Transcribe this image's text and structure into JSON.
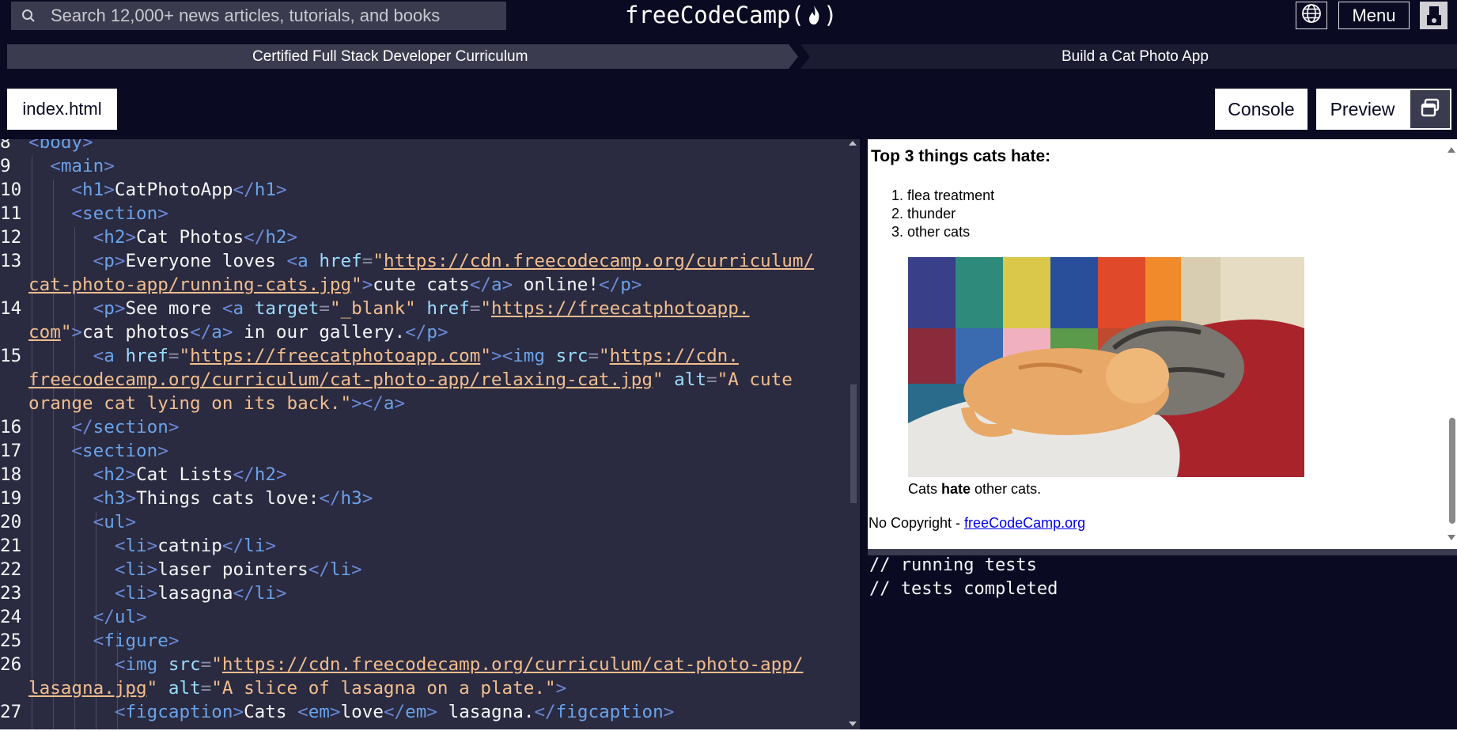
{
  "topnav": {
    "search_placeholder": "Search 12,000+ news articles, tutorials, and books",
    "logo_text": "freeCodeCamp",
    "logo_open": "(",
    "logo_close": ")",
    "menu_label": "Menu"
  },
  "breadcrumb": {
    "items": [
      "Certified Full Stack Developer Curriculum",
      "Build a Cat Photo App"
    ]
  },
  "tabs": {
    "file": "index.html",
    "console": "Console",
    "preview": "Preview"
  },
  "editor": {
    "lines": [
      {
        "n": "8",
        "html": "<span class='t'>&lt;</span><span class='tn'>body</span><span class='t'>&gt;</span>"
      },
      {
        "n": "9",
        "html": "  <span class='t'>&lt;</span><span class='tn'>main</span><span class='t'>&gt;</span>"
      },
      {
        "n": "10",
        "html": "    <span class='t'>&lt;</span><span class='tn'>h1</span><span class='t'>&gt;</span>CatPhotoApp<span class='t'>&lt;/</span><span class='tn'>h1</span><span class='t'>&gt;</span>"
      },
      {
        "n": "11",
        "html": "    <span class='t'>&lt;</span><span class='tn'>section</span><span class='t'>&gt;</span>"
      },
      {
        "n": "12",
        "html": "      <span class='t'>&lt;</span><span class='tn'>h2</span><span class='t'>&gt;</span>Cat Photos<span class='t'>&lt;/</span><span class='tn'>h2</span><span class='t'>&gt;</span>"
      },
      {
        "n": "13",
        "html": "      <span class='t'>&lt;</span><span class='tn'>p</span><span class='t'>&gt;</span>Everyone loves <span class='t'>&lt;</span><span class='tn'>a</span> <span class='at'>href</span><span class='p'>=</span><span class='s'>\"</span><span class='u'>https://cdn.freecodecamp.org/curriculum/</span>"
      },
      {
        "n": "",
        "html": "<span class='u'>cat-photo-app/running-cats.jpg</span><span class='s'>\"</span><span class='t'>&gt;</span>cute cats<span class='t'>&lt;/</span><span class='tn'>a</span><span class='t'>&gt;</span> online!<span class='t'>&lt;/</span><span class='tn'>p</span><span class='t'>&gt;</span>"
      },
      {
        "n": "14",
        "html": "      <span class='t'>&lt;</span><span class='tn'>p</span><span class='t'>&gt;</span>See more <span class='t'>&lt;</span><span class='tn'>a</span> <span class='at'>target</span><span class='p'>=</span><span class='s'>\"_blank\"</span> <span class='at'>href</span><span class='p'>=</span><span class='s'>\"</span><span class='u'>https://freecatphotoapp.</span>"
      },
      {
        "n": "",
        "html": "<span class='u'>com</span><span class='s'>\"</span><span class='t'>&gt;</span>cat photos<span class='t'>&lt;/</span><span class='tn'>a</span><span class='t'>&gt;</span> in our gallery.<span class='t'>&lt;/</span><span class='tn'>p</span><span class='t'>&gt;</span>"
      },
      {
        "n": "15",
        "html": "      <span class='t'>&lt;</span><span class='tn'>a</span> <span class='at'>href</span><span class='p'>=</span><span class='s'>\"</span><span class='u'>https://freecatphotoapp.com</span><span class='s'>\"</span><span class='t'>&gt;&lt;</span><span class='tn'>img</span> <span class='at'>src</span><span class='p'>=</span><span class='s'>\"</span><span class='u'>https://cdn.</span>"
      },
      {
        "n": "",
        "html": "<span class='u'>freecodecamp.org/curriculum/cat-photo-app/relaxing-cat.jpg</span><span class='s'>\"</span> <span class='at'>alt</span><span class='p'>=</span><span class='s'>\"A cute</span>"
      },
      {
        "n": "",
        "html": "<span class='s'>orange cat lying on its back.\"</span><span class='t'>&gt;&lt;/</span><span class='tn'>a</span><span class='t'>&gt;</span>"
      },
      {
        "n": "16",
        "html": "    <span class='t'>&lt;/</span><span class='tn'>section</span><span class='t'>&gt;</span>"
      },
      {
        "n": "17",
        "html": "    <span class='t'>&lt;</span><span class='tn'>section</span><span class='t'>&gt;</span>"
      },
      {
        "n": "18",
        "html": "      <span class='t'>&lt;</span><span class='tn'>h2</span><span class='t'>&gt;</span>Cat Lists<span class='t'>&lt;/</span><span class='tn'>h2</span><span class='t'>&gt;</span>"
      },
      {
        "n": "19",
        "html": "      <span class='t'>&lt;</span><span class='tn'>h3</span><span class='t'>&gt;</span>Things cats love:<span class='t'>&lt;/</span><span class='tn'>h3</span><span class='t'>&gt;</span>"
      },
      {
        "n": "20",
        "html": "      <span class='t'>&lt;</span><span class='tn'>ul</span><span class='t'>&gt;</span>"
      },
      {
        "n": "21",
        "html": "        <span class='t'>&lt;</span><span class='tn'>li</span><span class='t'>&gt;</span>catnip<span class='t'>&lt;/</span><span class='tn'>li</span><span class='t'>&gt;</span>"
      },
      {
        "n": "22",
        "html": "        <span class='t'>&lt;</span><span class='tn'>li</span><span class='t'>&gt;</span>laser pointers<span class='t'>&lt;/</span><span class='tn'>li</span><span class='t'>&gt;</span>"
      },
      {
        "n": "23",
        "html": "        <span class='t'>&lt;</span><span class='tn'>li</span><span class='t'>&gt;</span>lasagna<span class='t'>&lt;/</span><span class='tn'>li</span><span class='t'>&gt;</span>"
      },
      {
        "n": "24",
        "html": "      <span class='t'>&lt;/</span><span class='tn'>ul</span><span class='t'>&gt;</span>"
      },
      {
        "n": "25",
        "html": "      <span class='t'>&lt;</span><span class='tn'>figure</span><span class='t'>&gt;</span>"
      },
      {
        "n": "26",
        "html": "        <span class='t'>&lt;</span><span class='tn'>img</span> <span class='at'>src</span><span class='p'>=</span><span class='s'>\"</span><span class='u'>https://cdn.freecodecamp.org/curriculum/cat-photo-app/</span>"
      },
      {
        "n": "",
        "html": "<span class='u'>lasagna.jpg</span><span class='s'>\"</span> <span class='at'>alt</span><span class='p'>=</span><span class='s'>\"A slice of lasagna on a plate.\"</span><span class='t'>&gt;</span>"
      },
      {
        "n": "27",
        "html": "        <span class='t'>&lt;</span><span class='tn'>figcaption</span><span class='t'>&gt;</span>Cats <span class='t'>&lt;</span><span class='tn'>em</span><span class='t'>&gt;</span>love<span class='t'>&lt;/</span><span class='tn'>em</span><span class='t'>&gt;</span> lasagna.<span class='t'>&lt;/</span><span class='tn'>figcaption</span><span class='t'>&gt;</span>"
      }
    ]
  },
  "preview": {
    "heading": "Top 3 things cats hate:",
    "list": [
      "flea treatment",
      "thunder",
      "other cats"
    ],
    "list_markers": [
      "1.",
      "2.",
      "3."
    ],
    "caption_pre": "Cats ",
    "caption_bold": "hate",
    "caption_post": " other cats.",
    "footer_text": "No Copyright - ",
    "footer_link": "freeCodeCamp.org"
  },
  "console": {
    "lines": [
      "// running tests",
      "// tests completed"
    ]
  },
  "colors": {
    "nav_bg": "#0a0a23",
    "editor_bg": "#2a2a40",
    "url_color": "#f1be8e"
  }
}
